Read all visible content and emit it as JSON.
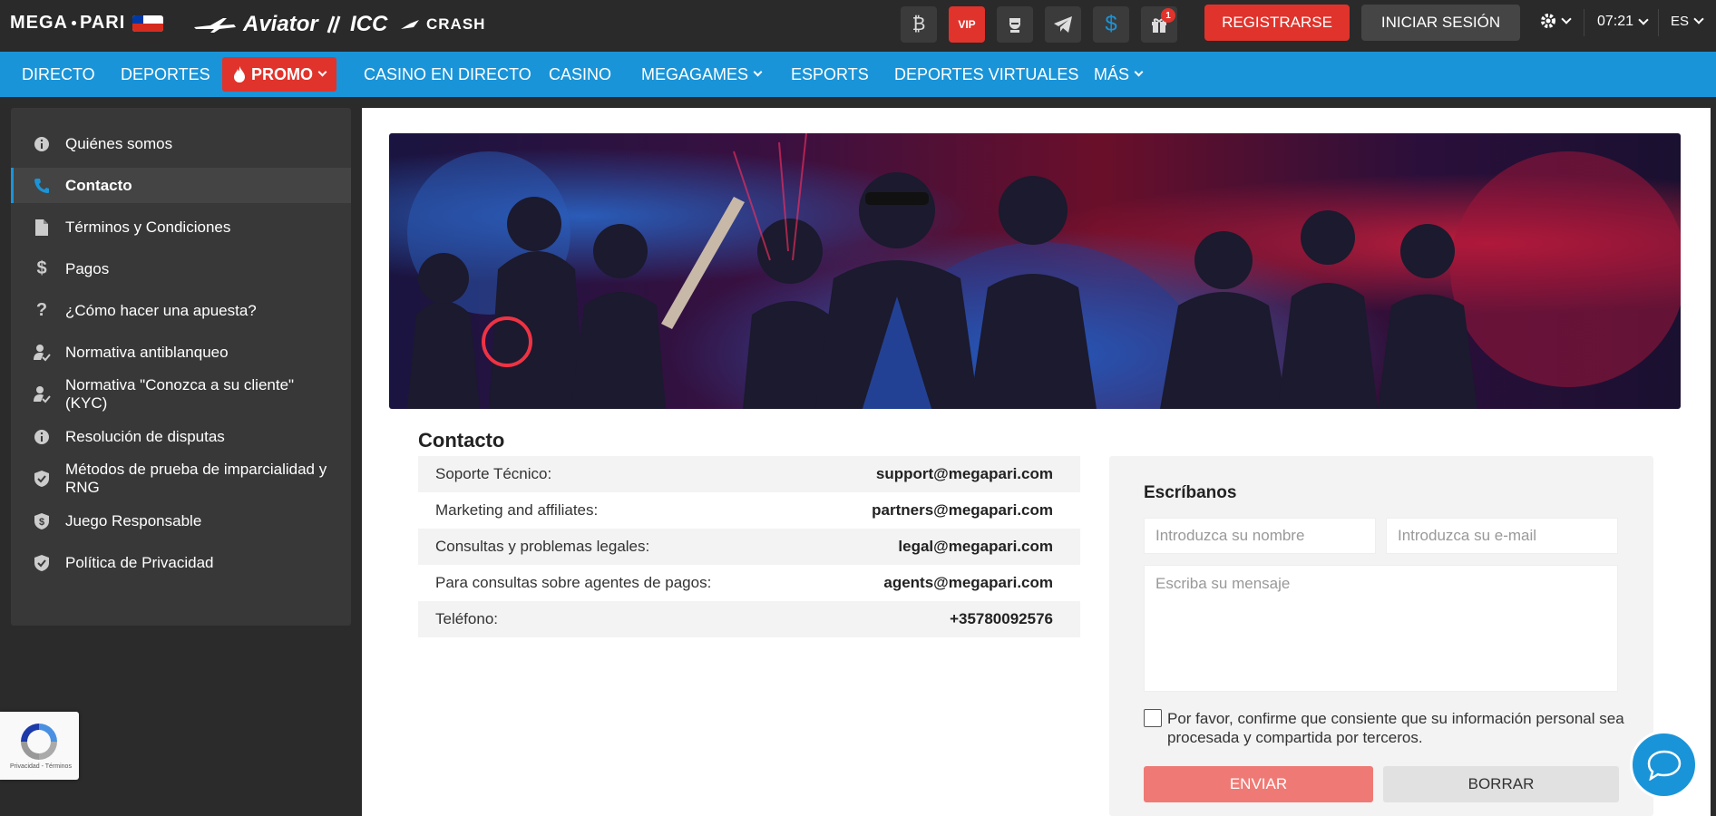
{
  "header": {
    "logo_left": "MEGA",
    "logo_right": "PARI",
    "brands": [
      "Aviator",
      "ICC",
      "CRASH"
    ],
    "vip_label": "VIP",
    "gift_badge": "1",
    "register_label": "REGISTRARSE",
    "login_label": "INICIAR SESIÓN",
    "time": "07:21",
    "lang": "ES"
  },
  "nav": {
    "items": [
      "DIRECTO",
      "DEPORTES",
      "PROMO",
      "CASINO EN DIRECTO",
      "CASINO",
      "MEGAGAMES",
      "ESPORTS",
      "DEPORTES VIRTUALES",
      "MÁS"
    ]
  },
  "sidebar": {
    "items": [
      {
        "label": "Quiénes somos",
        "icon": "info-icon"
      },
      {
        "label": "Contacto",
        "icon": "phone-icon"
      },
      {
        "label": "Términos y Condiciones",
        "icon": "document-icon"
      },
      {
        "label": "Pagos",
        "icon": "dollar-icon"
      },
      {
        "label": "¿Cómo hacer una apuesta?",
        "icon": "question-icon"
      },
      {
        "label": "Normativa antiblanqueo",
        "icon": "user-check-icon"
      },
      {
        "label": "Normativa \"Conozca a su cliente\" (KYC)",
        "icon": "user-check-icon"
      },
      {
        "label": "Resolución de disputas",
        "icon": "info-icon"
      },
      {
        "label": "Métodos de prueba de imparcialidad y RNG",
        "icon": "shield-check-icon"
      },
      {
        "label": "Juego Responsable",
        "icon": "shield-dollar-icon"
      },
      {
        "label": "Política de Privacidad",
        "icon": "shield-check-icon"
      }
    ]
  },
  "main": {
    "title": "Contacto",
    "rows": [
      {
        "label": "Soporte Técnico:",
        "value": "support@megapari.com"
      },
      {
        "label": "Marketing and affiliates:",
        "value": "partners@megapari.com"
      },
      {
        "label": "Consultas y problemas legales:",
        "value": "legal@megapari.com"
      },
      {
        "label": "Para consultas sobre agentes de pagos:",
        "value": "agents@megapari.com"
      },
      {
        "label": "Teléfono:",
        "value": "+35780092576"
      }
    ]
  },
  "form": {
    "title": "Escríbanos",
    "name_placeholder": "Introduzca su nombre",
    "email_placeholder": "Introduzca su e-mail",
    "message_placeholder": "Escriba su mensaje",
    "consent": "Por favor, confirme que consiente que su información personal sea procesada y compartida por terceros.",
    "send_label": "ENVIAR",
    "clear_label": "BORRAR"
  },
  "recaptcha": {
    "text": "Privacidad - Términos"
  },
  "colors": {
    "accent": "#1a94d8",
    "red": "#e0332b"
  }
}
